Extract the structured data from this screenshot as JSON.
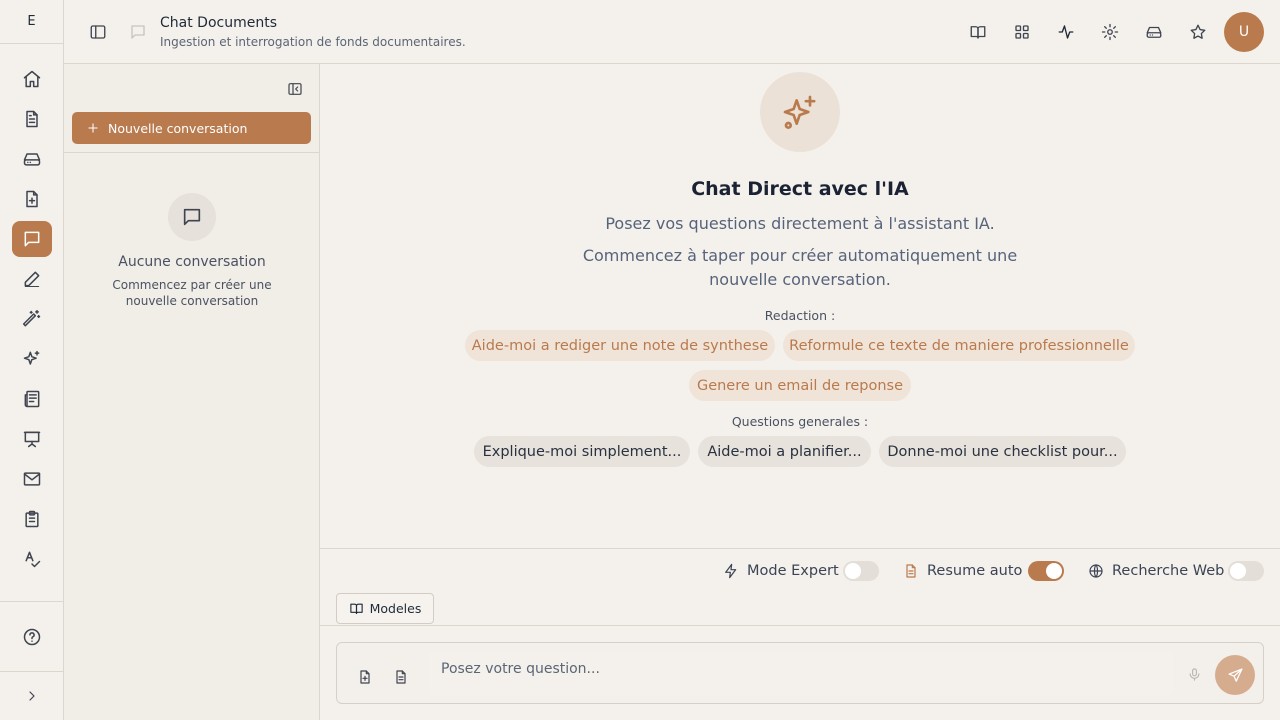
{
  "brand": {
    "initial": "E"
  },
  "colors": {
    "accent": "#b97a4d",
    "background": "#f4f1ec",
    "chip_warm": "#f0e4d9",
    "chip_neutral": "#e7e2db"
  },
  "rail": {
    "items": [
      {
        "icon": "home-icon"
      },
      {
        "icon": "document-icon"
      },
      {
        "icon": "drive-icon"
      },
      {
        "icon": "file-plus-icon"
      },
      {
        "icon": "chat-icon",
        "active": true
      },
      {
        "icon": "pen-icon"
      },
      {
        "icon": "magic-wand-icon"
      },
      {
        "icon": "sparkles-icon"
      },
      {
        "icon": "newspaper-icon"
      },
      {
        "icon": "presentation-icon"
      },
      {
        "icon": "mail-icon"
      },
      {
        "icon": "clipboard-icon"
      },
      {
        "icon": "spell-check-icon"
      }
    ],
    "bottom": [
      "help-icon",
      "chevron-right-icon"
    ]
  },
  "header": {
    "title": "Chat Documents",
    "subtitle": "Ingestion et interrogation de fonds documentaires.",
    "actions": [
      "book-open-icon",
      "grid-icon",
      "activity-icon",
      "settings-icon",
      "drive-icon",
      "star-icon"
    ],
    "avatar": "U"
  },
  "conversations": {
    "new_label": "Nouvelle conversation",
    "empty_title": "Aucune conversation",
    "empty_subtitle": "Commencez par créer une nouvelle conversation"
  },
  "main": {
    "title": "Chat Direct avec l'IA",
    "lead": "Posez vos questions directement à l'assistant IA.",
    "lead2": "Commencez à taper pour créer automatiquement une nouvelle conversation.",
    "categories": [
      {
        "label": "Redaction :",
        "chips": [
          "Aide-moi a rediger une note de synthese",
          "Reformule ce texte de maniere professionnelle",
          "Genere un email de reponse"
        ]
      },
      {
        "label": "Questions generales :",
        "chips": [
          "Explique-moi simplement...",
          "Aide-moi a planifier...",
          "Donne-moi une checklist pour..."
        ]
      }
    ]
  },
  "toggles": {
    "expert": {
      "label": "Mode Expert",
      "on": false
    },
    "summary": {
      "label": "Resume auto",
      "on": true
    },
    "web": {
      "label": "Recherche Web",
      "on": false
    }
  },
  "models_label": "Modeles",
  "composer": {
    "placeholder": "Posez votre question..."
  }
}
